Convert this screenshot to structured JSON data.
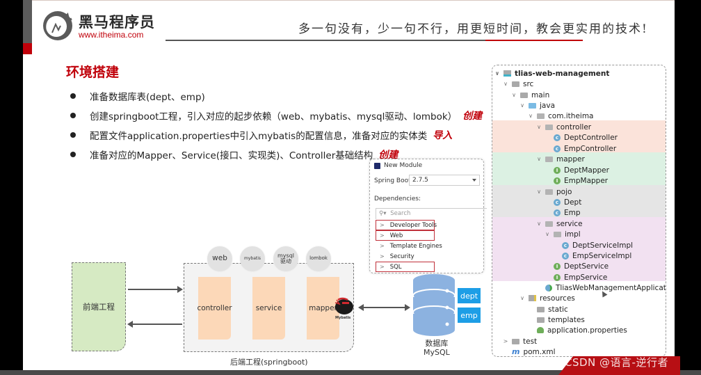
{
  "header": {
    "brand_cn": "黑马程序员",
    "brand_url": "www.itheima.com",
    "slogan": "多一句没有，少一句不行，用更短时间，教会更实用的技术!"
  },
  "section": {
    "title": "环境搭建",
    "bullets": [
      {
        "text": "准备数据库表(dept、emp)",
        "annotation": ""
      },
      {
        "text": "创建springboot工程，引入对应的起步依赖（web、mybatis、mysql驱动、lombok）",
        "annotation": "创建"
      },
      {
        "text": "配置文件application.properties中引入mybatis的配置信息，准备对应的实体类",
        "annotation": "导入"
      },
      {
        "text": "准备对应的Mapper、Service(接口、实现类)、Controller基础结构",
        "annotation": "创建"
      }
    ]
  },
  "new_module_dialog": {
    "title": "New Module",
    "spring_boot_label": "Spring Boot:",
    "spring_boot_version": "2.7.5",
    "dependencies_label": "Dependencies:",
    "search_placeholder": "Search",
    "items": [
      {
        "label": "Developer Tools",
        "highlighted": true
      },
      {
        "label": "Web",
        "highlighted": true
      },
      {
        "label": "Template Engines",
        "highlighted": false
      },
      {
        "label": "Security",
        "highlighted": false
      },
      {
        "label": "SQL",
        "highlighted": true
      }
    ]
  },
  "project_tree": {
    "nodes": [
      {
        "label": "tlias-web-management",
        "type": "root",
        "expanded": true
      },
      {
        "label": "src",
        "type": "folder",
        "expanded": true
      },
      {
        "label": "main",
        "type": "folder",
        "expanded": true
      },
      {
        "label": "java",
        "type": "source-folder",
        "expanded": true
      },
      {
        "label": "com.itheima",
        "type": "package",
        "expanded": true
      },
      {
        "label": "controller",
        "type": "package",
        "expanded": true
      },
      {
        "label": "DeptController",
        "type": "class"
      },
      {
        "label": "EmpController",
        "type": "class"
      },
      {
        "label": "mapper",
        "type": "package",
        "expanded": true
      },
      {
        "label": "DeptMapper",
        "type": "interface"
      },
      {
        "label": "EmpMapper",
        "type": "interface"
      },
      {
        "label": "pojo",
        "type": "package",
        "expanded": true
      },
      {
        "label": "Dept",
        "type": "class"
      },
      {
        "label": "Emp",
        "type": "class"
      },
      {
        "label": "service",
        "type": "package",
        "expanded": true
      },
      {
        "label": "impl",
        "type": "package",
        "expanded": true
      },
      {
        "label": "DeptServiceImpl",
        "type": "class"
      },
      {
        "label": "EmpServiceImpl",
        "type": "class"
      },
      {
        "label": "DeptService",
        "type": "interface"
      },
      {
        "label": "EmpService",
        "type": "interface"
      },
      {
        "label": "TliasWebManagementApplication",
        "type": "app-class"
      },
      {
        "label": "resources",
        "type": "resources-folder",
        "expanded": true
      },
      {
        "label": "static",
        "type": "folder"
      },
      {
        "label": "templates",
        "type": "folder"
      },
      {
        "label": "application.properties",
        "type": "properties"
      },
      {
        "label": "test",
        "type": "folder",
        "expanded": false
      },
      {
        "label": "pom.xml",
        "type": "maven"
      }
    ]
  },
  "diagram": {
    "frontend_label": "前端工程",
    "backend_label": "后端工程(springboot)",
    "layers": [
      "controller",
      "service",
      "mapper"
    ],
    "dependencies": [
      "web",
      "mybatis",
      "mysql",
      "驱动",
      "lombok"
    ],
    "mybatis_logo_label": "Mybatis",
    "database_label_cn": "数据库",
    "database_label_en": "MySQL",
    "tables": [
      "dept",
      "emp"
    ]
  },
  "watermark": "CSDN @语言-逆行者",
  "colors": {
    "brand_red": "#c0000a",
    "controller_band": "#fbe3da",
    "mapper_band": "#dcf1e3",
    "pojo_band": "#e5e5e5",
    "service_band": "#f2e1f1",
    "db_blue": "#8cb2e0",
    "table_tag": "#1d9ee6"
  }
}
